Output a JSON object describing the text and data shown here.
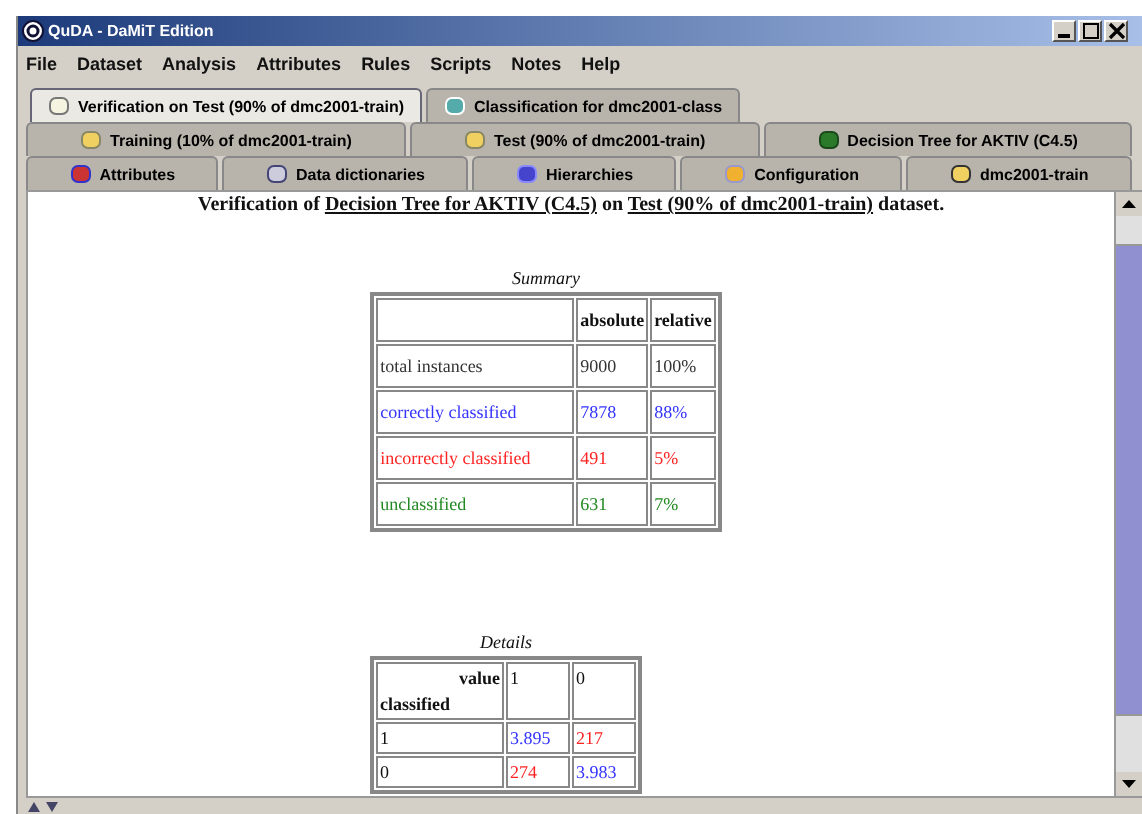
{
  "window": {
    "title": "QuDA - DaMiT Edition"
  },
  "menu": [
    "File",
    "Dataset",
    "Analysis",
    "Attributes",
    "Rules",
    "Scripts",
    "Notes",
    "Help"
  ],
  "tab_rows": [
    [
      {
        "label": "Verification on Test (90% of dmc2001-train)",
        "selected": true
      },
      {
        "label": "Classification for dmc2001-class",
        "selected": false
      }
    ],
    [
      {
        "label": "Training (10% of dmc2001-train)",
        "selected": false
      },
      {
        "label": "Test (90% of dmc2001-train)",
        "selected": false
      },
      {
        "label": "Decision Tree for AKTIV (C4.5)",
        "selected": false
      }
    ],
    [
      {
        "label": "Attributes",
        "selected": false
      },
      {
        "label": "Data dictionaries",
        "selected": false
      },
      {
        "label": "Hierarchies",
        "selected": false
      },
      {
        "label": "Configuration",
        "selected": false
      },
      {
        "label": "dmc2001-train",
        "selected": false
      }
    ]
  ],
  "heading": {
    "prefix": "Verification of",
    "model_link": "Decision Tree for AKTIV (C4.5)",
    "middle": "on",
    "dataset_link": "Test (90% of dmc2001-train)",
    "suffix": "dataset."
  },
  "summary": {
    "caption": "Summary",
    "columns": [
      "absolute",
      "relative"
    ],
    "rows": [
      {
        "label": "total instances",
        "absolute": "9000",
        "relative": "100%",
        "color": "#333333"
      },
      {
        "label": "correctly classified",
        "absolute": "7878",
        "relative": "88%",
        "color": "#3333ff"
      },
      {
        "label": "incorrectly classified",
        "absolute": "491",
        "relative": "5%",
        "color": "#ff2222"
      },
      {
        "label": "unclassified",
        "absolute": "631",
        "relative": "7%",
        "color": "#228822"
      }
    ]
  },
  "details": {
    "caption": "Details",
    "corner_top": "value",
    "corner_bottom": "classified",
    "columns": [
      "1",
      "0"
    ],
    "rows": [
      {
        "label": "1",
        "cells": [
          {
            "text": "3.895",
            "color": "#3333ff"
          },
          {
            "text": "217",
            "color": "#ff2222"
          }
        ]
      },
      {
        "label": "0",
        "cells": [
          {
            "text": "274",
            "color": "#ff2222"
          },
          {
            "text": "3.983",
            "color": "#3333ff"
          }
        ]
      }
    ]
  }
}
